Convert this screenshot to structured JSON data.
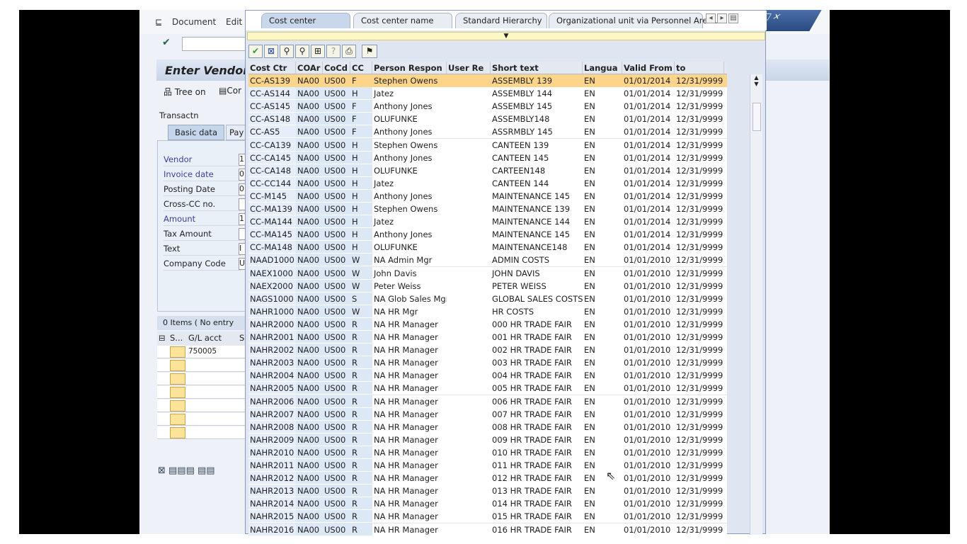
{
  "menu": {
    "document": "Document",
    "edit": "Edit"
  },
  "window_controls": "□ ×",
  "screen_title": "Enter Vendor",
  "toolbar_left": {
    "tree_on": "Tree on",
    "cor": "Cor"
  },
  "transactn_label": "Transactn",
  "form_tabs": {
    "basic": "Basic data",
    "pay": "Pay"
  },
  "form_fields": [
    {
      "label": "Vendor",
      "value": "1",
      "required": true
    },
    {
      "label": "Invoice date",
      "value": "0",
      "required": true
    },
    {
      "label": "Posting Date",
      "value": "0",
      "required": false
    },
    {
      "label": "Cross-CC no.",
      "value": "",
      "required": false
    },
    {
      "label": "Amount",
      "value": "1",
      "required": true
    },
    {
      "label": "Tax Amount",
      "value": "",
      "required": false
    },
    {
      "label": "Text",
      "value": "I",
      "required": false
    },
    {
      "label": "Company Code",
      "value": "U",
      "required": false
    }
  ],
  "items_label": "0 Items ( No entry",
  "gl_table": {
    "headers": [
      "S...",
      "G/L acct",
      "S"
    ],
    "first_value": "750005"
  },
  "popup": {
    "tabs": [
      "Cost center",
      "Cost center name",
      "Standard Hierarchy",
      "Organizational unit via Personnel Area..."
    ],
    "active_tab": "Cost center",
    "columns": [
      "Cost Ctr",
      "COAr",
      "CoCd",
      "CC",
      "Person Respon",
      "User Re",
      "Short text",
      "Langua",
      "Valid From",
      "to"
    ],
    "selected_row": 0,
    "rows": [
      [
        "CC-AS139",
        "NA00",
        "US00",
        "F",
        "Stephen Owens",
        "",
        "ASSEMBLY 139",
        "EN",
        "01/01/2014",
        "12/31/9999"
      ],
      [
        "CC-AS144",
        "NA00",
        "US00",
        "H",
        "Jatez",
        "",
        "ASSEMBLY 144",
        "EN",
        "01/01/2014",
        "12/31/9999"
      ],
      [
        "CC-AS145",
        "NA00",
        "US00",
        "F",
        "Anthony Jones",
        "",
        "ASSEMBLY 145",
        "EN",
        "01/01/2014",
        "12/31/9999"
      ],
      [
        "CC-AS148",
        "NA00",
        "US00",
        "F",
        "OLUFUNKE",
        "",
        "ASSEMBLY148",
        "EN",
        "01/01/2014",
        "12/31/9999"
      ],
      [
        "CC-AS5",
        "NA00",
        "US00",
        "F",
        "Anthony Jones",
        "",
        "ASSRMBLY 145",
        "EN",
        "01/01/2014",
        "12/31/9999"
      ],
      [
        "CC-CA139",
        "NA00",
        "US00",
        "H",
        "Stephen Owens",
        "",
        "CANTEEN 139",
        "EN",
        "01/01/2014",
        "12/31/9999"
      ],
      [
        "CC-CA145",
        "NA00",
        "US00",
        "H",
        "Anthony Jones",
        "",
        "CANTEEN 145",
        "EN",
        "01/01/2014",
        "12/31/9999"
      ],
      [
        "CC-CA148",
        "NA00",
        "US00",
        "H",
        "OLUFUNKE",
        "",
        "CARTEEN148",
        "EN",
        "01/01/2014",
        "12/31/9999"
      ],
      [
        "CC-CC144",
        "NA00",
        "US00",
        "H",
        "Jatez",
        "",
        "CANTEEN 144",
        "EN",
        "01/01/2014",
        "12/31/9999"
      ],
      [
        "CC-M145",
        "NA00",
        "US00",
        "H",
        "Anthony Jones",
        "",
        "MAINTENANCE 145",
        "EN",
        "01/01/2014",
        "12/31/9999"
      ],
      [
        "CC-MA139",
        "NA00",
        "US00",
        "H",
        "Stephen Owens",
        "",
        "MAINTENANCE 139",
        "EN",
        "01/01/2014",
        "12/31/9999"
      ],
      [
        "CC-MA144",
        "NA00",
        "US00",
        "H",
        "Jatez",
        "",
        "MAINTENANCE 144",
        "EN",
        "01/01/2014",
        "12/31/9999"
      ],
      [
        "CC-MA145",
        "NA00",
        "US00",
        "H",
        "Anthony Jones",
        "",
        "MAINTENANCE 145",
        "EN",
        "01/01/2014",
        "12/31/9999"
      ],
      [
        "CC-MA148",
        "NA00",
        "US00",
        "H",
        "OLUFUNKE",
        "",
        "MAINTENANCE148",
        "EN",
        "01/01/2014",
        "12/31/9999"
      ],
      [
        "NAAD1000",
        "NA00",
        "US00",
        "W",
        "NA Admin Mgr",
        "",
        "ADMIN COSTS",
        "EN",
        "01/01/2010",
        "12/31/9999"
      ],
      [
        "NAEX1000",
        "NA00",
        "US00",
        "W",
        "John Davis",
        "",
        "JOHN DAVIS",
        "EN",
        "01/01/2010",
        "12/31/9999"
      ],
      [
        "NAEX2000",
        "NA00",
        "US00",
        "W",
        "Peter Weiss",
        "",
        "PETER WEISS",
        "EN",
        "01/01/2010",
        "12/31/9999"
      ],
      [
        "NAGS1000",
        "NA00",
        "US00",
        "S",
        "NA Glob Sales Mgr",
        "",
        "GLOBAL SALES COSTS",
        "EN",
        "01/01/2010",
        "12/31/9999"
      ],
      [
        "NAHR1000",
        "NA00",
        "US00",
        "W",
        "NA HR Mgr",
        "",
        "HR COSTS",
        "EN",
        "01/01/2010",
        "12/31/9999"
      ],
      [
        "NAHR2000",
        "NA00",
        "US00",
        "R",
        "NA HR Manager",
        "",
        "000 HR TRADE FAIR",
        "EN",
        "01/01/2010",
        "12/31/9999"
      ],
      [
        "NAHR2001",
        "NA00",
        "US00",
        "R",
        "NA HR Manager",
        "",
        "001 HR TRADE FAIR",
        "EN",
        "01/01/2010",
        "12/31/9999"
      ],
      [
        "NAHR2002",
        "NA00",
        "US00",
        "R",
        "NA HR Manager",
        "",
        "002 HR TRADE FAIR",
        "EN",
        "01/01/2010",
        "12/31/9999"
      ],
      [
        "NAHR2003",
        "NA00",
        "US00",
        "R",
        "NA HR Manager",
        "",
        "003 HR TRADE FAIR",
        "EN",
        "01/01/2010",
        "12/31/9999"
      ],
      [
        "NAHR2004",
        "NA00",
        "US00",
        "R",
        "NA HR Manager",
        "",
        "004 HR TRADE FAIR",
        "EN",
        "01/01/2010",
        "12/31/9999"
      ],
      [
        "NAHR2005",
        "NA00",
        "US00",
        "R",
        "NA HR Manager",
        "",
        "005 HR TRADE FAIR",
        "EN",
        "01/01/2010",
        "12/31/9999"
      ],
      [
        "NAHR2006",
        "NA00",
        "US00",
        "R",
        "NA HR Manager",
        "",
        "006 HR TRADE FAIR",
        "EN",
        "01/01/2010",
        "12/31/9999"
      ],
      [
        "NAHR2007",
        "NA00",
        "US00",
        "R",
        "NA HR Manager",
        "",
        "007 HR TRADE FAIR",
        "EN",
        "01/01/2010",
        "12/31/9999"
      ],
      [
        "NAHR2008",
        "NA00",
        "US00",
        "R",
        "NA HR Manager",
        "",
        "008 HR TRADE FAIR",
        "EN",
        "01/01/2010",
        "12/31/9999"
      ],
      [
        "NAHR2009",
        "NA00",
        "US00",
        "R",
        "NA HR Manager",
        "",
        "009 HR TRADE FAIR",
        "EN",
        "01/01/2010",
        "12/31/9999"
      ],
      [
        "NAHR2010",
        "NA00",
        "US00",
        "R",
        "NA HR Manager",
        "",
        "010 HR TRADE FAIR",
        "EN",
        "01/01/2010",
        "12/31/9999"
      ],
      [
        "NAHR2011",
        "NA00",
        "US00",
        "R",
        "NA HR Manager",
        "",
        "011 HR TRADE FAIR",
        "EN",
        "01/01/2010",
        "12/31/9999"
      ],
      [
        "NAHR2012",
        "NA00",
        "US00",
        "R",
        "NA HR Manager",
        "",
        "012 HR TRADE FAIR",
        "EN",
        "01/01/2010",
        "12/31/9999"
      ],
      [
        "NAHR2013",
        "NA00",
        "US00",
        "R",
        "NA HR Manager",
        "",
        "013 HR TRADE FAIR",
        "EN",
        "01/01/2010",
        "12/31/9999"
      ],
      [
        "NAHR2014",
        "NA00",
        "US00",
        "R",
        "NA HR Manager",
        "",
        "014 HR TRADE FAIR",
        "EN",
        "01/01/2010",
        "12/31/9999"
      ],
      [
        "NAHR2015",
        "NA00",
        "US00",
        "R",
        "NA HR Manager",
        "",
        "015 HR TRADE FAIR",
        "EN",
        "01/01/2010",
        "12/31/9999"
      ],
      [
        "NAHR2016",
        "NA00",
        "US00",
        "R",
        "NA HR Manager",
        "",
        "016 HR TRADE FAIR",
        "EN",
        "01/01/2010",
        "12/31/9999"
      ]
    ]
  },
  "colors": {
    "selected_row": "#fcd58a",
    "key_column": "#e6eefa",
    "title_bar": "#c8d5e8"
  }
}
